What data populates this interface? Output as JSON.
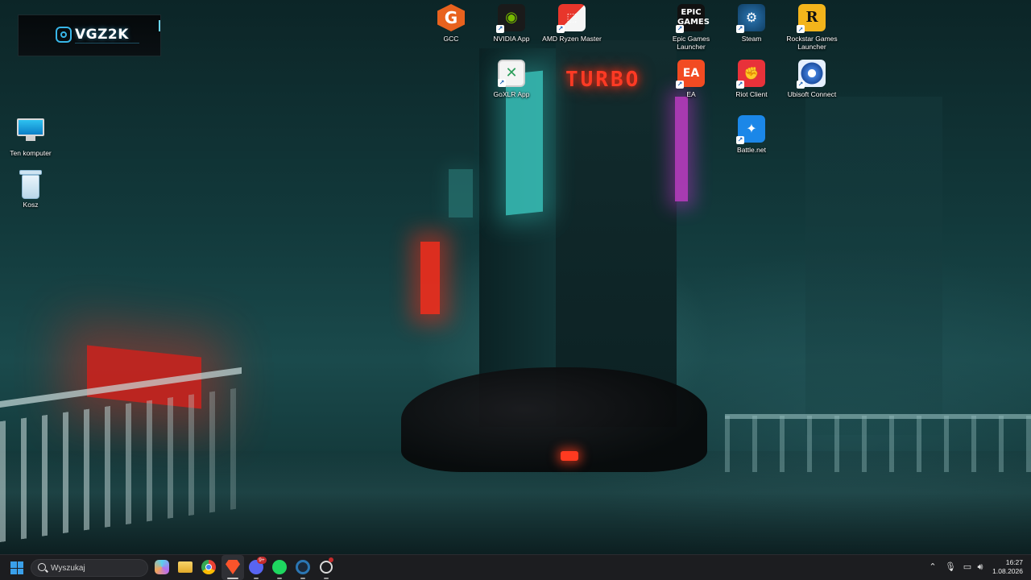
{
  "logo_widget": {
    "text": "VGZ2K"
  },
  "desktop": {
    "left_icons": [
      {
        "label": "Ten komputer",
        "icon": "computer-icon"
      },
      {
        "label": "Kosz",
        "icon": "recycle-bin-icon"
      }
    ],
    "top_icons": [
      {
        "label": "GCC",
        "icon": "gcc-icon",
        "glyph": "G"
      },
      {
        "label": "NVIDIA App",
        "icon": "nvidia-icon",
        "glyph": "◉"
      },
      {
        "label": "AMD Ryzen Master",
        "icon": "amd-ryzen-master-icon",
        "glyph": "⬚"
      },
      {
        "label": "Epic Games\nLauncher",
        "icon": "epic-games-icon",
        "glyph": "EPIC\nGAMES"
      },
      {
        "label": "Steam",
        "icon": "steam-icon",
        "glyph": "⚙"
      },
      {
        "label": "Rockstar Games\nLauncher",
        "icon": "rockstar-icon",
        "glyph": "R"
      },
      {
        "label": "GoXLR App",
        "icon": "goxlr-icon",
        "glyph": "✕"
      },
      {
        "label": "EA",
        "icon": "ea-icon",
        "glyph": "EA"
      },
      {
        "label": "Riot Client",
        "icon": "riot-client-icon",
        "glyph": "✊"
      },
      {
        "label": "Ubisoft Connect",
        "icon": "ubisoft-icon",
        "glyph": ""
      },
      {
        "label": "Battle.net",
        "icon": "battlenet-icon",
        "glyph": "✦"
      }
    ],
    "wallpaper_sign": "TURBO"
  },
  "taskbar": {
    "search_placeholder": "Wyszukaj",
    "discord_badge": "9+",
    "clock_time": "16:27",
    "clock_date": "1.08.2026"
  },
  "colors": {
    "taskbar_bg": "#1c1d20",
    "accent": "#3aa0ea",
    "neon_red": "#ff2c1a",
    "neon_cyan": "#3fd8cf"
  }
}
